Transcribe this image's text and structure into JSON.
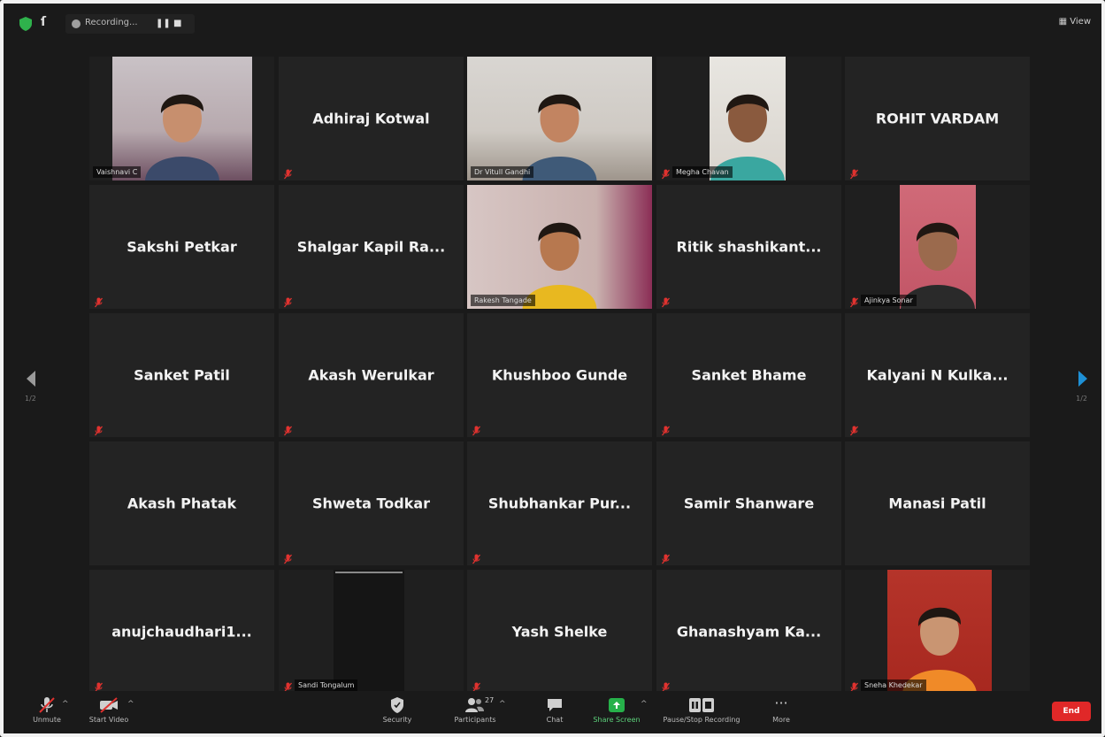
{
  "topbar": {
    "recording_label": "Recording...",
    "view_label": "View"
  },
  "tiles": [
    {
      "name": "Vaishnavi C",
      "type": "video",
      "mic_muted": false
    },
    {
      "name": "Adhiraj Kotwal",
      "type": "name",
      "mic_muted": true
    },
    {
      "name": "Dr Vitull Gandhi",
      "type": "video",
      "mic_muted": false
    },
    {
      "name": "Megha Chavan",
      "type": "video",
      "mic_muted": true
    },
    {
      "name": "ROHIT VARDAM",
      "type": "name",
      "mic_muted": true
    },
    {
      "name": "Sakshi Petkar",
      "type": "name",
      "mic_muted": true
    },
    {
      "name": "Shalgar Kapil Ra...",
      "type": "name",
      "mic_muted": true
    },
    {
      "name": "Rakesh Tangade",
      "type": "video",
      "mic_muted": false,
      "active": true
    },
    {
      "name": "Ritik shashikant...",
      "type": "name",
      "mic_muted": true
    },
    {
      "name": "Ajinkya Sonar",
      "type": "video",
      "mic_muted": true
    },
    {
      "name": "Sanket Patil",
      "type": "name",
      "mic_muted": true
    },
    {
      "name": "Akash Werulkar",
      "type": "name",
      "mic_muted": true
    },
    {
      "name": "Khushboo Gunde",
      "type": "name",
      "mic_muted": true
    },
    {
      "name": "Sanket Bhame",
      "type": "name",
      "mic_muted": true
    },
    {
      "name": "Kalyani N Kulka...",
      "type": "name",
      "mic_muted": true
    },
    {
      "name": "Akash Phatak",
      "type": "name",
      "mic_muted": false
    },
    {
      "name": "Shweta Todkar",
      "type": "name",
      "mic_muted": true
    },
    {
      "name": "Shubhankar Pur...",
      "type": "name",
      "mic_muted": true
    },
    {
      "name": "Samir Shanware",
      "type": "name",
      "mic_muted": true
    },
    {
      "name": "Manasi Patil",
      "type": "name",
      "mic_muted": false
    },
    {
      "name": "anujchaudhari1...",
      "type": "name",
      "mic_muted": true
    },
    {
      "name": "Sandi Tongalum",
      "type": "video",
      "mic_muted": true
    },
    {
      "name": "Yash Shelke",
      "type": "name",
      "mic_muted": true
    },
    {
      "name": "Ghanashyam Ka...",
      "type": "name",
      "mic_muted": true
    },
    {
      "name": "Sneha Khedekar",
      "type": "video",
      "mic_muted": true
    }
  ],
  "pagination": {
    "left": "1/2",
    "right": "1/2"
  },
  "toolbar": {
    "unmute": "Unmute",
    "start_video": "Start Video",
    "security": "Security",
    "participants": "Participants",
    "participants_count": "27",
    "chat": "Chat",
    "share_screen": "Share Screen",
    "pause_stop_recording": "Pause/Stop Recording",
    "more": "More",
    "end": "End"
  },
  "colors": {
    "background": "#1a1a1a",
    "tile": "#232323",
    "active_speaker": "#d2d67a",
    "share_green": "#26b14a",
    "end_red": "#e02828",
    "muted_red": "#e0322f",
    "arrow_blue": "#1e90d6"
  }
}
